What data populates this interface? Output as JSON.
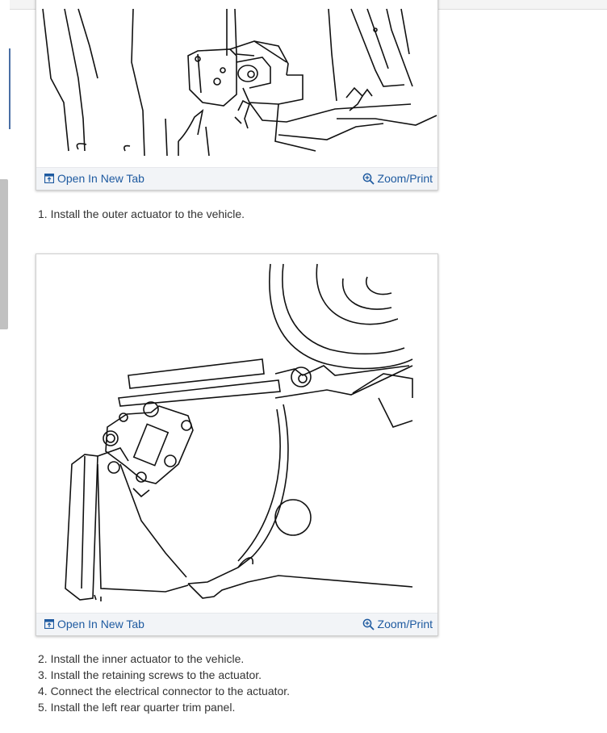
{
  "figures": [
    {
      "open_label": "Open In New Tab",
      "zoom_label": "Zoom/Print",
      "open_icon": "open-new-tab-icon",
      "zoom_icon": "magnifier-zoom-icon"
    },
    {
      "open_label": "Open In New Tab",
      "zoom_label": "Zoom/Print",
      "open_icon": "open-new-tab-icon",
      "zoom_icon": "magnifier-zoom-icon"
    }
  ],
  "steps_first": [
    "1. Install the outer actuator to the vehicle."
  ],
  "steps_second": [
    "2. Install the inner actuator to the vehicle.",
    "3. Install the retaining screws to the actuator.",
    "4. Connect the electrical connector to the actuator.",
    "5. Install the left rear quarter trim panel."
  ],
  "colors": {
    "link": "#1e5aa0",
    "toolbar_bg": "#f2f4f7",
    "text": "#333333",
    "scrollbar": "#c1c1c1"
  }
}
